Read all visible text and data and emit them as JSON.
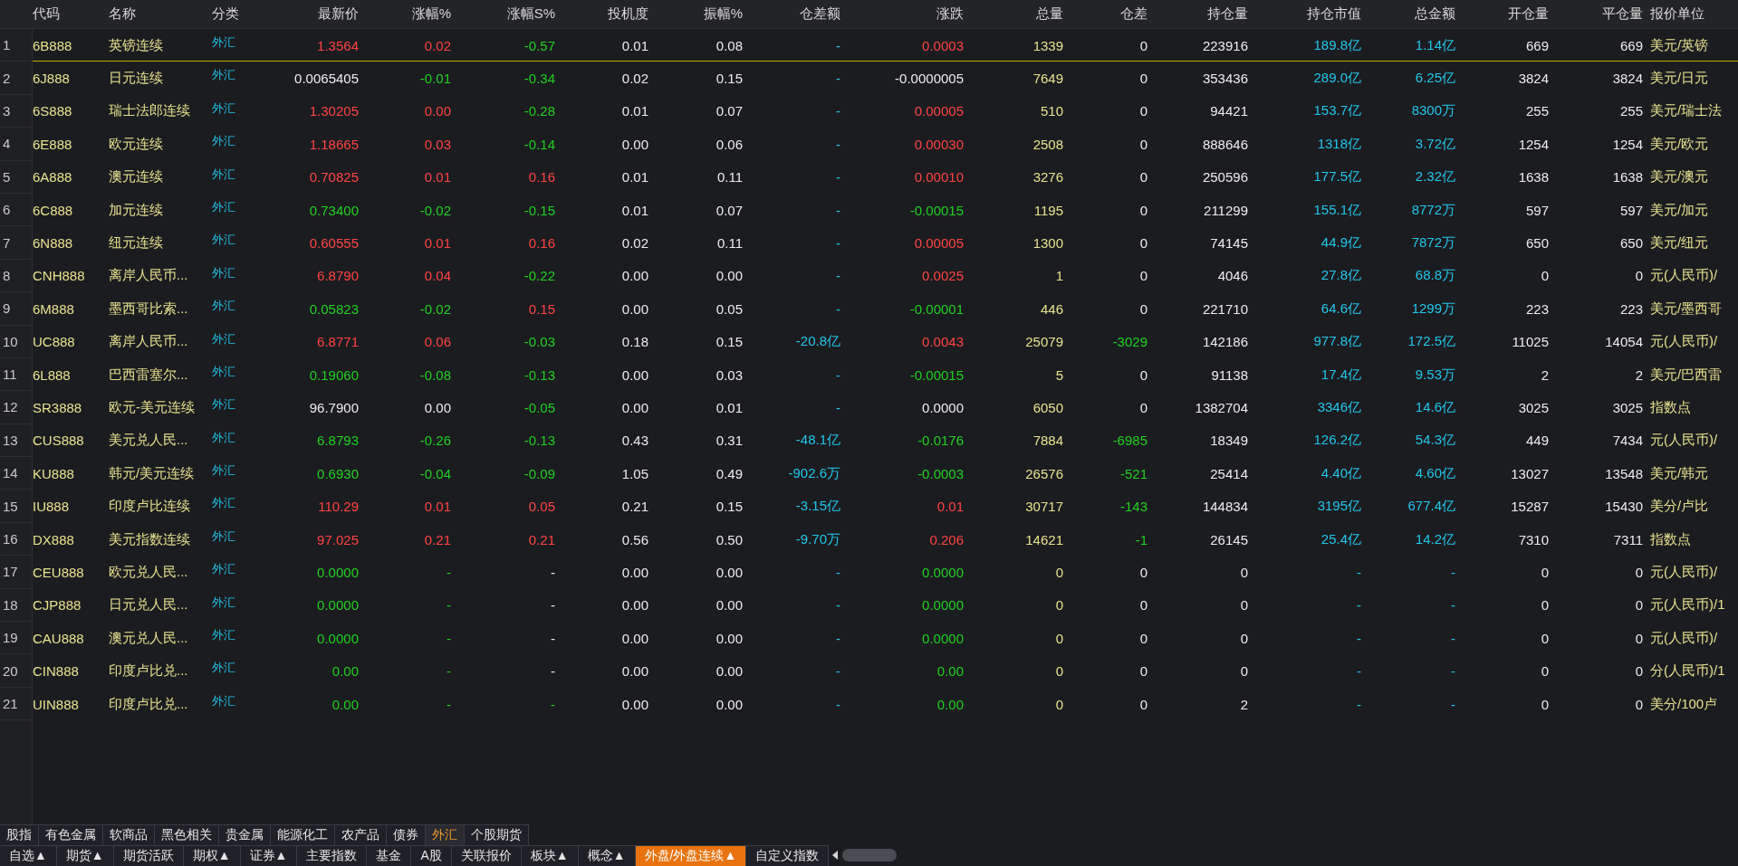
{
  "table": {
    "columns": [
      "代码",
      "名称",
      "分类",
      "最新价",
      "涨幅%",
      "涨幅S%",
      "投机度",
      "振幅%",
      "仓差额",
      "涨跌",
      "总量",
      "仓差",
      "持仓量",
      "持仓市值",
      "总金额",
      "开仓量",
      "平仓量",
      "报价单位"
    ],
    "rows": [
      {
        "no": "1",
        "selected": true,
        "code": "6B888",
        "name": "英镑连续",
        "category": "外汇",
        "price": {
          "text": "1.3564",
          "color": "#ff4444"
        },
        "change_pct": {
          "text": "0.02",
          "color": "#ff4444"
        },
        "change_s_pct": {
          "text": "-0.57",
          "color": "#1fd21f"
        },
        "speculation": "0.01",
        "amplitude": "0.08",
        "oi_amount": "-",
        "change": {
          "text": "0.0003",
          "color": "#ff4444"
        },
        "volume": "1339",
        "oi_change": {
          "text": "0",
          "color": "#ececec"
        },
        "open_interest": "223916",
        "oi_value": "189.8亿",
        "turnover": "1.14亿",
        "open_volume": "669",
        "close_volume": "669",
        "unit": "美元/英镑"
      },
      {
        "no": "2",
        "selected": false,
        "code": "6J888",
        "name": "日元连续",
        "category": "外汇",
        "price": {
          "text": "0.0065405",
          "color": "#ececec"
        },
        "change_pct": {
          "text": "-0.01",
          "color": "#1fd21f"
        },
        "change_s_pct": {
          "text": "-0.34",
          "color": "#1fd21f"
        },
        "speculation": "0.02",
        "amplitude": "0.15",
        "oi_amount": "-",
        "change": {
          "text": "-0.0000005",
          "color": "#ececec"
        },
        "volume": "7649",
        "oi_change": {
          "text": "0",
          "color": "#ececec"
        },
        "open_interest": "353436",
        "oi_value": "289.0亿",
        "turnover": "6.25亿",
        "open_volume": "3824",
        "close_volume": "3824",
        "unit": "美元/日元"
      },
      {
        "no": "3",
        "selected": false,
        "code": "6S888",
        "name": "瑞士法郎连续",
        "category": "外汇",
        "price": {
          "text": "1.30205",
          "color": "#ff4444"
        },
        "change_pct": {
          "text": "0.00",
          "color": "#ff4444"
        },
        "change_s_pct": {
          "text": "-0.28",
          "color": "#1fd21f"
        },
        "speculation": "0.01",
        "amplitude": "0.07",
        "oi_amount": "-",
        "change": {
          "text": "0.00005",
          "color": "#ff4444"
        },
        "volume": "510",
        "oi_change": {
          "text": "0",
          "color": "#ececec"
        },
        "open_interest": "94421",
        "oi_value": "153.7亿",
        "turnover": "8300万",
        "open_volume": "255",
        "close_volume": "255",
        "unit": "美元/瑞士法"
      },
      {
        "no": "4",
        "selected": false,
        "code": "6E888",
        "name": "欧元连续",
        "category": "外汇",
        "price": {
          "text": "1.18665",
          "color": "#ff4444"
        },
        "change_pct": {
          "text": "0.03",
          "color": "#ff4444"
        },
        "change_s_pct": {
          "text": "-0.14",
          "color": "#1fd21f"
        },
        "speculation": "0.00",
        "amplitude": "0.06",
        "oi_amount": "-",
        "change": {
          "text": "0.00030",
          "color": "#ff4444"
        },
        "volume": "2508",
        "oi_change": {
          "text": "0",
          "color": "#ececec"
        },
        "open_interest": "888646",
        "oi_value": "1318亿",
        "turnover": "3.72亿",
        "open_volume": "1254",
        "close_volume": "1254",
        "unit": "美元/欧元"
      },
      {
        "no": "5",
        "selected": false,
        "code": "6A888",
        "name": "澳元连续",
        "category": "外汇",
        "price": {
          "text": "0.70825",
          "color": "#ff4444"
        },
        "change_pct": {
          "text": "0.01",
          "color": "#ff4444"
        },
        "change_s_pct": {
          "text": "0.16",
          "color": "#ff4444"
        },
        "speculation": "0.01",
        "amplitude": "0.11",
        "oi_amount": "-",
        "change": {
          "text": "0.00010",
          "color": "#ff4444"
        },
        "volume": "3276",
        "oi_change": {
          "text": "0",
          "color": "#ececec"
        },
        "open_interest": "250596",
        "oi_value": "177.5亿",
        "turnover": "2.32亿",
        "open_volume": "1638",
        "close_volume": "1638",
        "unit": "美元/澳元"
      },
      {
        "no": "6",
        "selected": false,
        "code": "6C888",
        "name": "加元连续",
        "category": "外汇",
        "price": {
          "text": "0.73400",
          "color": "#1fd21f"
        },
        "change_pct": {
          "text": "-0.02",
          "color": "#1fd21f"
        },
        "change_s_pct": {
          "text": "-0.15",
          "color": "#1fd21f"
        },
        "speculation": "0.01",
        "amplitude": "0.07",
        "oi_amount": "-",
        "change": {
          "text": "-0.00015",
          "color": "#1fd21f"
        },
        "volume": "1195",
        "oi_change": {
          "text": "0",
          "color": "#ececec"
        },
        "open_interest": "211299",
        "oi_value": "155.1亿",
        "turnover": "8772万",
        "open_volume": "597",
        "close_volume": "597",
        "unit": "美元/加元"
      },
      {
        "no": "7",
        "selected": false,
        "code": "6N888",
        "name": "纽元连续",
        "category": "外汇",
        "price": {
          "text": "0.60555",
          "color": "#ff4444"
        },
        "change_pct": {
          "text": "0.01",
          "color": "#ff4444"
        },
        "change_s_pct": {
          "text": "0.16",
          "color": "#ff4444"
        },
        "speculation": "0.02",
        "amplitude": "0.11",
        "oi_amount": "-",
        "change": {
          "text": "0.00005",
          "color": "#ff4444"
        },
        "volume": "1300",
        "oi_change": {
          "text": "0",
          "color": "#ececec"
        },
        "open_interest": "74145",
        "oi_value": "44.9亿",
        "turnover": "7872万",
        "open_volume": "650",
        "close_volume": "650",
        "unit": "美元/纽元"
      },
      {
        "no": "8",
        "selected": false,
        "code": "CNH888",
        "name": "离岸人民币...",
        "category": "外汇",
        "price": {
          "text": "6.8790",
          "color": "#ff4444"
        },
        "change_pct": {
          "text": "0.04",
          "color": "#ff4444"
        },
        "change_s_pct": {
          "text": "-0.22",
          "color": "#1fd21f"
        },
        "speculation": "0.00",
        "amplitude": "0.00",
        "oi_amount": "-",
        "change": {
          "text": "0.0025",
          "color": "#ff4444"
        },
        "volume": "1",
        "oi_change": {
          "text": "0",
          "color": "#ececec"
        },
        "open_interest": "4046",
        "oi_value": "27.8亿",
        "turnover": "68.8万",
        "open_volume": "0",
        "close_volume": "0",
        "unit": "元(人民币)/"
      },
      {
        "no": "9",
        "selected": false,
        "code": "6M888",
        "name": "墨西哥比索...",
        "category": "外汇",
        "price": {
          "text": "0.05823",
          "color": "#1fd21f"
        },
        "change_pct": {
          "text": "-0.02",
          "color": "#1fd21f"
        },
        "change_s_pct": {
          "text": "0.15",
          "color": "#ff4444"
        },
        "speculation": "0.00",
        "amplitude": "0.05",
        "oi_amount": "-",
        "change": {
          "text": "-0.00001",
          "color": "#1fd21f"
        },
        "volume": "446",
        "oi_change": {
          "text": "0",
          "color": "#ececec"
        },
        "open_interest": "221710",
        "oi_value": "64.6亿",
        "turnover": "1299万",
        "open_volume": "223",
        "close_volume": "223",
        "unit": "美元/墨西哥"
      },
      {
        "no": "10",
        "selected": false,
        "code": "UC888",
        "name": "离岸人民币...",
        "category": "外汇",
        "price": {
          "text": "6.8771",
          "color": "#ff4444"
        },
        "change_pct": {
          "text": "0.06",
          "color": "#ff4444"
        },
        "change_s_pct": {
          "text": "-0.03",
          "color": "#1fd21f"
        },
        "speculation": "0.18",
        "amplitude": "0.15",
        "oi_amount": "-20.8亿",
        "change": {
          "text": "0.0043",
          "color": "#ff4444"
        },
        "volume": "25079",
        "oi_change": {
          "text": "-3029",
          "color": "#1fd21f"
        },
        "open_interest": "142186",
        "oi_value": "977.8亿",
        "turnover": "172.5亿",
        "open_volume": "11025",
        "close_volume": "14054",
        "unit": "元(人民币)/"
      },
      {
        "no": "11",
        "selected": false,
        "code": "6L888",
        "name": "巴西雷塞尔...",
        "category": "外汇",
        "price": {
          "text": "0.19060",
          "color": "#1fd21f"
        },
        "change_pct": {
          "text": "-0.08",
          "color": "#1fd21f"
        },
        "change_s_pct": {
          "text": "-0.13",
          "color": "#1fd21f"
        },
        "speculation": "0.00",
        "amplitude": "0.03",
        "oi_amount": "-",
        "change": {
          "text": "-0.00015",
          "color": "#1fd21f"
        },
        "volume": "5",
        "oi_change": {
          "text": "0",
          "color": "#ececec"
        },
        "open_interest": "91138",
        "oi_value": "17.4亿",
        "turnover": "9.53万",
        "open_volume": "2",
        "close_volume": "2",
        "unit": "美元/巴西雷"
      },
      {
        "no": "12",
        "selected": false,
        "code": "SR3888",
        "name": "欧元-美元连续",
        "category": "外汇",
        "price": {
          "text": "96.7900",
          "color": "#ececec"
        },
        "change_pct": {
          "text": "0.00",
          "color": "#ececec"
        },
        "change_s_pct": {
          "text": "-0.05",
          "color": "#1fd21f"
        },
        "speculation": "0.00",
        "amplitude": "0.01",
        "oi_amount": "-",
        "change": {
          "text": "0.0000",
          "color": "#ececec"
        },
        "volume": "6050",
        "oi_change": {
          "text": "0",
          "color": "#ececec"
        },
        "open_interest": "1382704",
        "oi_value": "3346亿",
        "turnover": "14.6亿",
        "open_volume": "3025",
        "close_volume": "3025",
        "unit": "指数点"
      },
      {
        "no": "13",
        "selected": false,
        "code": "CUS888",
        "name": "美元兑人民...",
        "category": "外汇",
        "price": {
          "text": "6.8793",
          "color": "#1fd21f"
        },
        "change_pct": {
          "text": "-0.26",
          "color": "#1fd21f"
        },
        "change_s_pct": {
          "text": "-0.13",
          "color": "#1fd21f"
        },
        "speculation": "0.43",
        "amplitude": "0.31",
        "oi_amount": "-48.1亿",
        "change": {
          "text": "-0.0176",
          "color": "#1fd21f"
        },
        "volume": "7884",
        "oi_change": {
          "text": "-6985",
          "color": "#1fd21f"
        },
        "open_interest": "18349",
        "oi_value": "126.2亿",
        "turnover": "54.3亿",
        "open_volume": "449",
        "close_volume": "7434",
        "unit": "元(人民币)/"
      },
      {
        "no": "14",
        "selected": false,
        "code": "KU888",
        "name": "韩元/美元连续",
        "category": "外汇",
        "price": {
          "text": "0.6930",
          "color": "#1fd21f"
        },
        "change_pct": {
          "text": "-0.04",
          "color": "#1fd21f"
        },
        "change_s_pct": {
          "text": "-0.09",
          "color": "#1fd21f"
        },
        "speculation": "1.05",
        "amplitude": "0.49",
        "oi_amount": "-902.6万",
        "change": {
          "text": "-0.0003",
          "color": "#1fd21f"
        },
        "volume": "26576",
        "oi_change": {
          "text": "-521",
          "color": "#1fd21f"
        },
        "open_interest": "25414",
        "oi_value": "4.40亿",
        "turnover": "4.60亿",
        "open_volume": "13027",
        "close_volume": "13548",
        "unit": "美元/韩元"
      },
      {
        "no": "15",
        "selected": false,
        "code": "IU888",
        "name": "印度卢比连续",
        "category": "外汇",
        "price": {
          "text": "110.29",
          "color": "#ff4444"
        },
        "change_pct": {
          "text": "0.01",
          "color": "#ff4444"
        },
        "change_s_pct": {
          "text": "0.05",
          "color": "#ff4444"
        },
        "speculation": "0.21",
        "amplitude": "0.15",
        "oi_amount": "-3.15亿",
        "change": {
          "text": "0.01",
          "color": "#ff4444"
        },
        "volume": "30717",
        "oi_change": {
          "text": "-143",
          "color": "#1fd21f"
        },
        "open_interest": "144834",
        "oi_value": "3195亿",
        "turnover": "677.4亿",
        "open_volume": "15287",
        "close_volume": "15430",
        "unit": "美分/卢比"
      },
      {
        "no": "16",
        "selected": false,
        "code": "DX888",
        "name": "美元指数连续",
        "category": "外汇",
        "price": {
          "text": "97.025",
          "color": "#ff4444"
        },
        "change_pct": {
          "text": "0.21",
          "color": "#ff4444"
        },
        "change_s_pct": {
          "text": "0.21",
          "color": "#ff4444"
        },
        "speculation": "0.56",
        "amplitude": "0.50",
        "oi_amount": "-9.70万",
        "change": {
          "text": "0.206",
          "color": "#ff4444"
        },
        "volume": "14621",
        "oi_change": {
          "text": "-1",
          "color": "#1fd21f"
        },
        "open_interest": "26145",
        "oi_value": "25.4亿",
        "turnover": "14.2亿",
        "open_volume": "7310",
        "close_volume": "7311",
        "unit": "指数点"
      },
      {
        "no": "17",
        "selected": false,
        "code": "CEU888",
        "name": "欧元兑人民...",
        "category": "外汇",
        "price": {
          "text": "0.0000",
          "color": "#1fd21f"
        },
        "change_pct": {
          "text": "-",
          "color": "#1fd21f"
        },
        "change_s_pct": {
          "text": "-",
          "color": "#ececec"
        },
        "speculation": "0.00",
        "amplitude": "0.00",
        "oi_amount": "-",
        "change": {
          "text": "0.0000",
          "color": "#1fd21f"
        },
        "volume": "0",
        "oi_change": {
          "text": "0",
          "color": "#ececec"
        },
        "open_interest": "0",
        "oi_value": "-",
        "turnover": "-",
        "open_volume": "0",
        "close_volume": "0",
        "unit": "元(人民币)/"
      },
      {
        "no": "18",
        "selected": false,
        "code": "CJP888",
        "name": "日元兑人民...",
        "category": "外汇",
        "price": {
          "text": "0.0000",
          "color": "#1fd21f"
        },
        "change_pct": {
          "text": "-",
          "color": "#1fd21f"
        },
        "change_s_pct": {
          "text": "-",
          "color": "#ececec"
        },
        "speculation": "0.00",
        "amplitude": "0.00",
        "oi_amount": "-",
        "change": {
          "text": "0.0000",
          "color": "#1fd21f"
        },
        "volume": "0",
        "oi_change": {
          "text": "0",
          "color": "#ececec"
        },
        "open_interest": "0",
        "oi_value": "-",
        "turnover": "-",
        "open_volume": "0",
        "close_volume": "0",
        "unit": "元(人民币)/1"
      },
      {
        "no": "19",
        "selected": false,
        "code": "CAU888",
        "name": "澳元兑人民...",
        "category": "外汇",
        "price": {
          "text": "0.0000",
          "color": "#1fd21f"
        },
        "change_pct": {
          "text": "-",
          "color": "#1fd21f"
        },
        "change_s_pct": {
          "text": "-",
          "color": "#ececec"
        },
        "speculation": "0.00",
        "amplitude": "0.00",
        "oi_amount": "-",
        "change": {
          "text": "0.0000",
          "color": "#1fd21f"
        },
        "volume": "0",
        "oi_change": {
          "text": "0",
          "color": "#ececec"
        },
        "open_interest": "0",
        "oi_value": "-",
        "turnover": "-",
        "open_volume": "0",
        "close_volume": "0",
        "unit": "元(人民币)/"
      },
      {
        "no": "20",
        "selected": false,
        "code": "CIN888",
        "name": "印度卢比兑...",
        "category": "外汇",
        "price": {
          "text": "0.00",
          "color": "#1fd21f"
        },
        "change_pct": {
          "text": "-",
          "color": "#1fd21f"
        },
        "change_s_pct": {
          "text": "-",
          "color": "#ececec"
        },
        "speculation": "0.00",
        "amplitude": "0.00",
        "oi_amount": "-",
        "change": {
          "text": "0.00",
          "color": "#1fd21f"
        },
        "volume": "0",
        "oi_change": {
          "text": "0",
          "color": "#ececec"
        },
        "open_interest": "0",
        "oi_value": "-",
        "turnover": "-",
        "open_volume": "0",
        "close_volume": "0",
        "unit": "分(人民币)/1"
      },
      {
        "no": "21",
        "selected": false,
        "code": "UIN888",
        "name": "印度卢比兑...",
        "category": "外汇",
        "price": {
          "text": "0.00",
          "color": "#1fd21f"
        },
        "change_pct": {
          "text": "-",
          "color": "#1fd21f"
        },
        "change_s_pct": {
          "text": "-",
          "color": "#1fd21f"
        },
        "speculation": "0.00",
        "amplitude": "0.00",
        "oi_amount": "-",
        "change": {
          "text": "0.00",
          "color": "#1fd21f"
        },
        "volume": "0",
        "oi_change": {
          "text": "0",
          "color": "#ececec"
        },
        "open_interest": "2",
        "oi_value": "-",
        "turnover": "-",
        "open_volume": "0",
        "close_volume": "0",
        "unit": "美分/100卢"
      }
    ]
  },
  "category_tabs": [
    {
      "label": "股指",
      "selected": false
    },
    {
      "label": "有色金属",
      "selected": false
    },
    {
      "label": "软商品",
      "selected": false
    },
    {
      "label": "黑色相关",
      "selected": false
    },
    {
      "label": "贵金属",
      "selected": false
    },
    {
      "label": "能源化工",
      "selected": false
    },
    {
      "label": "农产品",
      "selected": false
    },
    {
      "label": "债券",
      "selected": false
    },
    {
      "label": "外汇",
      "selected": true
    },
    {
      "label": "个股期货",
      "selected": false
    }
  ],
  "market_tabs": [
    {
      "label": "自选▲",
      "selected": false
    },
    {
      "label": "期货▲",
      "selected": false
    },
    {
      "label": "期货活跃",
      "selected": false
    },
    {
      "label": "期权▲",
      "selected": false
    },
    {
      "label": "证券▲",
      "selected": false
    },
    {
      "label": "主要指数",
      "selected": false
    },
    {
      "label": "基金",
      "selected": false
    },
    {
      "label": "A股",
      "selected": false
    },
    {
      "label": "关联报价",
      "selected": false
    },
    {
      "label": "板块▲",
      "selected": false
    },
    {
      "label": "概念▲",
      "selected": false
    },
    {
      "label": "外盘/外盘连续▲",
      "selected": true
    },
    {
      "label": "自定义指数",
      "selected": false
    }
  ]
}
